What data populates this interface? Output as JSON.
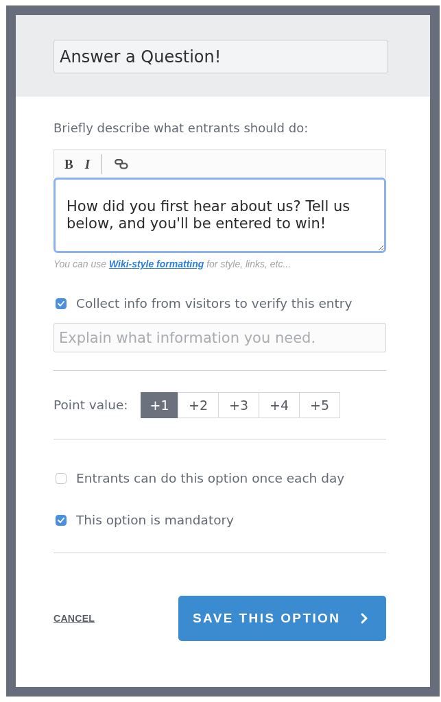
{
  "header": {
    "title_field": {
      "value": "Answer a Question!"
    }
  },
  "description": {
    "label": "Briefly describe what entrants should do:",
    "toolbar": [
      {
        "kind": "bold",
        "label": "B"
      },
      {
        "kind": "italic",
        "label": "I"
      },
      {
        "kind": "separator"
      },
      {
        "kind": "link"
      }
    ],
    "value": "How did you first hear about us? Tell us below, and you'll be entered to win!",
    "focused": true,
    "hint": {
      "before": "You can use ",
      "link": "Wiki-style formatting",
      "after": " for style, links, etc..."
    }
  },
  "verify": {
    "label": "Collect info from visitors to verify this entry",
    "checked": true,
    "field": {
      "placeholder": "Explain what information you need."
    }
  },
  "points": {
    "label": "Point value:",
    "options": [
      {
        "label": "+1",
        "selected": true
      },
      {
        "label": "+2",
        "selected": false
      },
      {
        "label": "+3",
        "selected": false
      },
      {
        "label": "+4",
        "selected": false
      },
      {
        "label": "+5",
        "selected": false
      }
    ]
  },
  "options": [
    {
      "label": "Entrants can do this option once each day",
      "checked": false
    },
    {
      "label": "This option is mandatory",
      "checked": true
    }
  ],
  "footer": {
    "cancel": "CANCEL",
    "save": "SAVE THIS OPTION"
  }
}
